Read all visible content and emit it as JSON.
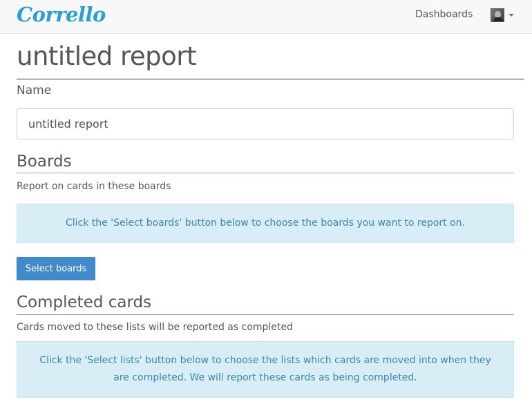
{
  "navbar": {
    "brand": "Corrello",
    "dashboards_link": "Dashboards",
    "user_avatar_icon": "user-avatar-icon"
  },
  "page": {
    "title": "untitled report"
  },
  "name_field": {
    "label": "Name",
    "value": "untitled report"
  },
  "boards": {
    "heading": "Boards",
    "description": "Report on cards in these boards",
    "info": "Click the 'Select boards' button below to choose the boards you want to report on.",
    "button_label": "Select boards"
  },
  "completed_cards": {
    "heading": "Completed cards",
    "description": "Cards moved to these lists will be reported as completed",
    "info": "Click the 'Select lists' button below to choose the lists which cards are moved into when they are completed. We will report these cards as being completed."
  },
  "colors": {
    "brand": "#2a9fd6",
    "primary_button": "#428bca",
    "info_background": "#d9edf7",
    "info_text": "#3a87ad"
  }
}
